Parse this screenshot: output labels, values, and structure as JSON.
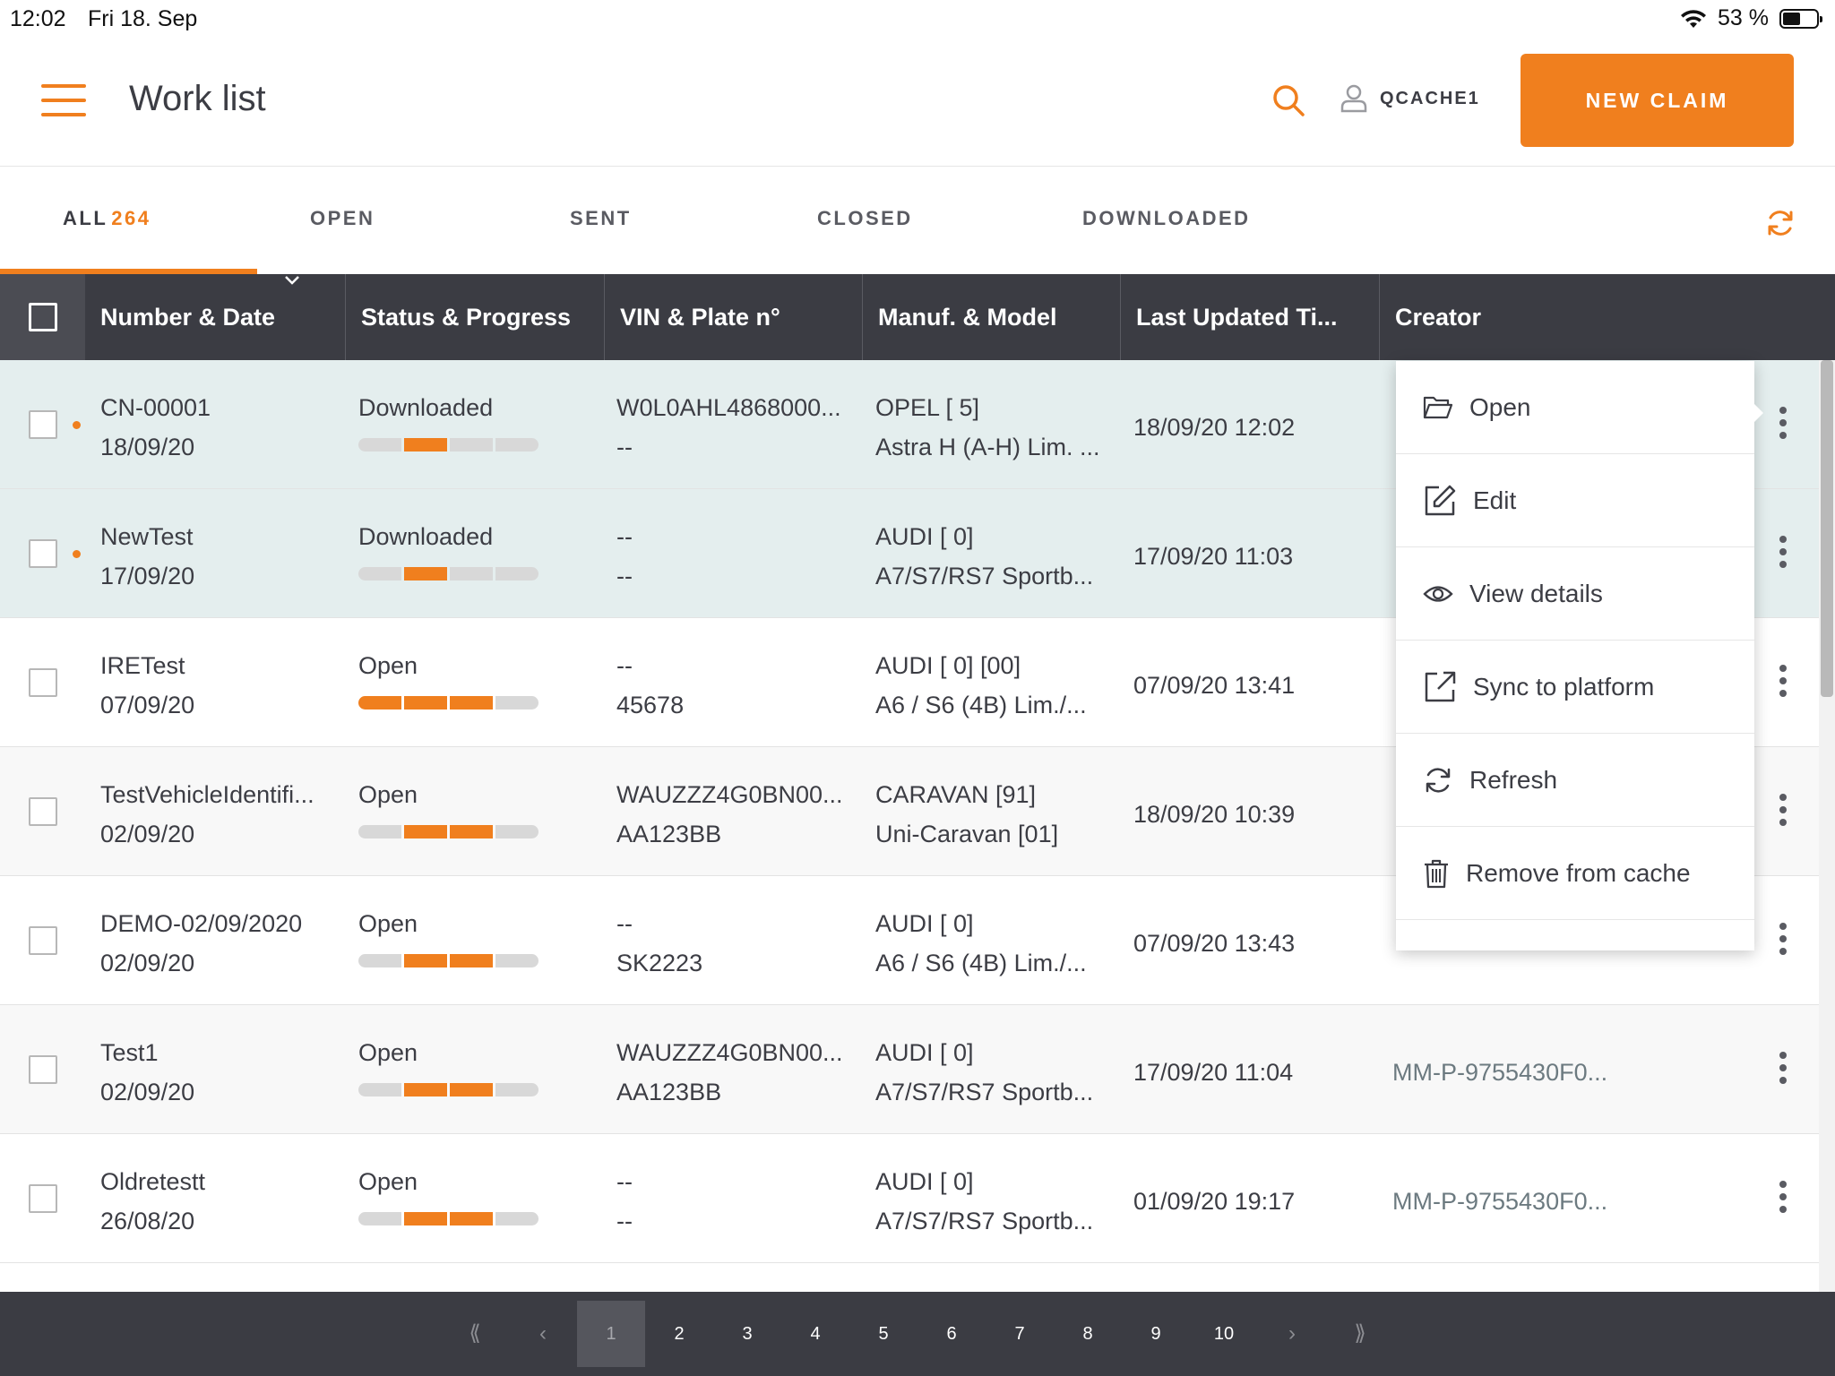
{
  "status_bar": {
    "time": "12:02",
    "date": "Fri 18. Sep",
    "battery": "53 %"
  },
  "header": {
    "title": "Work list",
    "user": "QCACHE1",
    "new_claim": "NEW CLAIM"
  },
  "tabs": [
    {
      "label": "ALL",
      "count": "264"
    },
    {
      "label": "OPEN"
    },
    {
      "label": "SENT"
    },
    {
      "label": "CLOSED"
    },
    {
      "label": "DOWNLOADED"
    }
  ],
  "columns": [
    "Number & Date",
    "Status & Progress",
    "VIN & Plate n°",
    "Manuf. & Model",
    "Last Updated Ti...",
    "Creator"
  ],
  "rows": [
    {
      "number": "CN-00001",
      "date": "18/09/20",
      "status": "Downloaded",
      "progress_filled": 1,
      "progress_total": 4,
      "vin": "W0L0AHL4868000...",
      "plate": "--",
      "manuf": "OPEL [ 5]",
      "model": "Astra H (A-H) Lim. ...",
      "updated": "18/09/20 12:02",
      "creator": ""
    },
    {
      "number": "NewTest",
      "date": "17/09/20",
      "status": "Downloaded",
      "progress_filled": 1,
      "progress_total": 4,
      "vin": "--",
      "plate": "--",
      "manuf": "AUDI [ 0]",
      "model": "A7/S7/RS7 Sportb...",
      "updated": "17/09/20 11:03",
      "creator": ""
    },
    {
      "number": "IRETest",
      "date": "07/09/20",
      "status": "Open",
      "progress_filled": 3,
      "progress_total": 4,
      "vin": "--",
      "plate": "45678",
      "manuf": "AUDI [ 0] [00]",
      "model": "A6 / S6 (4B) Lim./...",
      "updated": "07/09/20 13:41",
      "creator": ""
    },
    {
      "number": "TestVehicleIdentifi...",
      "date": "02/09/20",
      "status": "Open",
      "progress_filled": 2,
      "progress_total": 4,
      "vin": "WAUZZZ4G0BN00...",
      "plate": "AA123BB",
      "manuf": "CARAVAN [91]",
      "model": "Uni-Caravan [01]",
      "updated": "18/09/20 10:39",
      "creator": ""
    },
    {
      "number": "DEMO-02/09/2020",
      "date": "02/09/20",
      "status": "Open",
      "progress_filled": 2,
      "progress_total": 4,
      "vin": "--",
      "plate": "SK2223",
      "manuf": "AUDI [ 0]",
      "model": "A6 / S6 (4B) Lim./...",
      "updated": "07/09/20 13:43",
      "creator": ""
    },
    {
      "number": "Test1",
      "date": "02/09/20",
      "status": "Open",
      "progress_filled": 2,
      "progress_total": 4,
      "vin": "WAUZZZ4G0BN00...",
      "plate": "AA123BB",
      "manuf": "AUDI [ 0]",
      "model": "A7/S7/RS7 Sportb...",
      "updated": "17/09/20 11:04",
      "creator": "MM-P-9755430F0..."
    },
    {
      "number": "Oldretestt",
      "date": "26/08/20",
      "status": "Open",
      "progress_filled": 2,
      "progress_total": 4,
      "vin": "--",
      "plate": "--",
      "manuf": "AUDI [ 0]",
      "model": "A7/S7/RS7 Sportb...",
      "updated": "01/09/20 19:17",
      "creator": "MM-P-9755430F0..."
    }
  ],
  "context_menu": [
    {
      "label": "Open",
      "icon": "folder-open-icon"
    },
    {
      "label": "Edit",
      "icon": "edit-icon"
    },
    {
      "label": "View details",
      "icon": "eye-icon"
    },
    {
      "label": "Sync to platform",
      "icon": "external-link-icon"
    },
    {
      "label": "Refresh",
      "icon": "refresh-icon"
    },
    {
      "label": "Remove from cache",
      "icon": "trash-icon"
    }
  ],
  "pagination": {
    "first": "⟪",
    "prev": "‹",
    "pages": [
      "1",
      "2",
      "3",
      "4",
      "5",
      "6",
      "7",
      "8",
      "9",
      "10"
    ],
    "current": "1",
    "next": "›",
    "last": "⟫"
  },
  "colors": {
    "accent": "#f07f1e",
    "header_dark": "#3b3c43",
    "selected_row": "#e4eeee"
  }
}
